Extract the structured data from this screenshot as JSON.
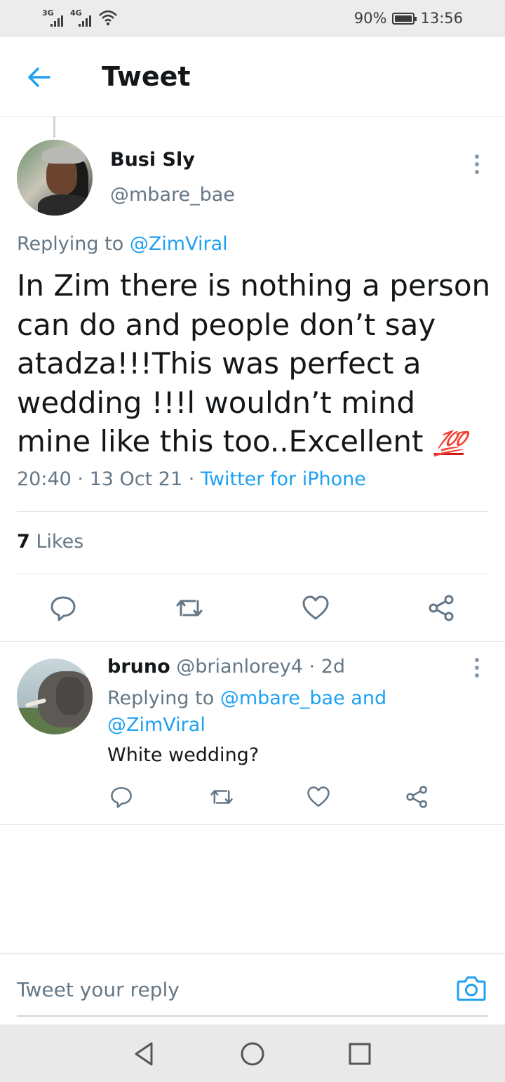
{
  "status_bar": {
    "network1": "3G",
    "network2": "4G",
    "battery_text": "90%",
    "battery_level": 0.9,
    "time": "13:56",
    "icons": [
      "signal-icon",
      "wifi-icon",
      "battery-icon"
    ]
  },
  "header": {
    "title": "Tweet",
    "back_icon": "back-arrow-icon"
  },
  "main_tweet": {
    "author_name": "Busi Sly",
    "author_handle": "@mbare_bae",
    "replying_prefix": "Replying to ",
    "replying_to": "@ZimViral",
    "text": "In Zim there is nothing a person can do and people don’t say atadza!!!This was perfect a wedding !!!l wouldn’t mind mine like this too..Excellent ",
    "emoji": "💯",
    "time": "20:40",
    "date": "13 Oct 21",
    "source": "Twitter for iPhone",
    "likes_count": "7",
    "likes_label": "Likes"
  },
  "reply": {
    "author_name": "bruno",
    "author_handle": "@brianlorey4",
    "age": "2d",
    "replying_prefix": "Replying to ",
    "replying_to_1": "@mbare_bae",
    "and": " and ",
    "replying_to_2": "@ZimViral",
    "text": "White wedding?"
  },
  "composer": {
    "placeholder": "Tweet your reply"
  },
  "colors": {
    "accent": "#1da1f2",
    "secondary_text": "#657786",
    "primary_text": "#14171a"
  }
}
